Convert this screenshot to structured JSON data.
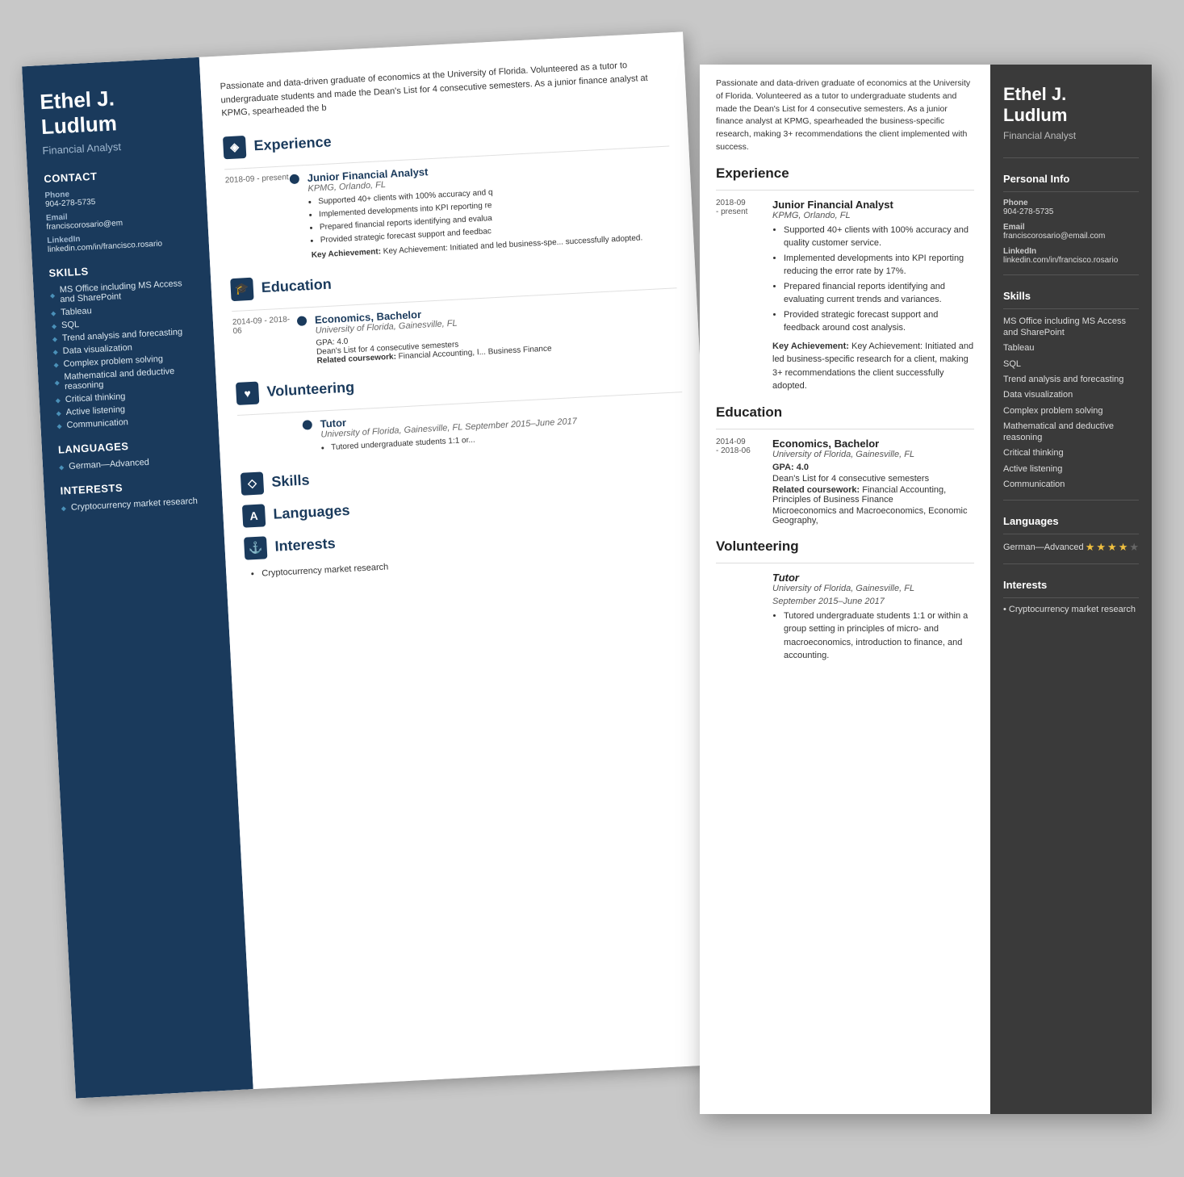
{
  "scene": {
    "bg": "#c8c8c8"
  },
  "resume_back": {
    "sidebar": {
      "name": "Ethel J. Ludlum",
      "title": "Financial Analyst",
      "phone_label": "Phone",
      "phone": "904-278-5735",
      "email_label": "Email",
      "email": "franciscorosario@em",
      "linkedin_label": "LinkedIn",
      "linkedin": "linkedin.com/in/francisco.rosario",
      "skills_label": "Skills",
      "skills": [
        "MS Office including MS Access and SharePoint",
        "Tableau",
        "SQL",
        "Trend analysis and forecasting",
        "Data visualization",
        "Complex problem solving",
        "Mathematical and deductive reasoning",
        "Critical thinking",
        "Active listening",
        "Communication"
      ],
      "languages_label": "Languages",
      "languages": "German—Advanced",
      "interests_label": "Interests",
      "interests": "Cryptocurrency market research"
    },
    "main": {
      "summary": "Passionate and data-driven graduate of economics at the University of Florida. Volunteered as a tutor to undergraduate students and made the Dean's List for 4 consecutive semesters. As a junior finance analyst at KPMG, spearheaded the b",
      "experience_title": "Experience",
      "exp_date": "2018-09 - present",
      "exp_job_title": "Junior Financial Analyst",
      "exp_company": "KPMG, Orlando, FL",
      "exp_bullets": [
        "Supported 40+ clients with 100% accuracy and q",
        "Implemented developments into KPI reporting re",
        "Prepared financial reports identifying and evalua",
        "Provided strategic forecast support and feedbac"
      ],
      "exp_key_ach": "Key Achievement: Initiated and led business-spe... successfully adopted.",
      "education_title": "Education",
      "edu_date": "2014-09 - 2018-06",
      "edu_degree": "Economics, Bachelor",
      "edu_school": "University of Florida, Gainesville, FL",
      "edu_gpa": "GPA: 4.0",
      "edu_deans": "Dean's List for 4 consecutive semesters",
      "edu_coursework_label": "Related coursework:",
      "edu_coursework": "Financial Accounting, I... Business Finance",
      "volunteering_title": "Volunteering",
      "vol_role": "Tutor",
      "vol_org": "University of Florida, Gainesville, FL September 2015–June 2017",
      "vol_bullet": "Tutored undergraduate students 1:1 or...",
      "skills_section_title": "Skills",
      "languages_section_title": "Languages",
      "interests_section_title": "Interests",
      "interests_bullet": "Cryptocurrency market research"
    }
  },
  "resume_front": {
    "main": {
      "summary": "Passionate and data-driven graduate of economics at the University of Florida. Volunteered as a tutor to undergraduate students and made the Dean's List for 4 consecutive semesters. As a junior finance analyst at KPMG, spearheaded the business-specific research, making 3+ recommendations the client implemented with success.",
      "experience_title": "Experience",
      "exp_date": "2018-09\n- present",
      "exp_job_title": "Junior Financial Analyst",
      "exp_company": "KPMG, Orlando, FL",
      "exp_bullet1": "Supported 40+ clients with 100% accuracy and quality customer service.",
      "exp_bullet2": "Implemented developments into KPI reporting reducing the error rate by 17%.",
      "exp_bullet3": "Prepared financial reports identifying and evaluating current trends and variances.",
      "exp_bullet4": "Provided strategic forecast support and feedback around cost analysis.",
      "exp_key_ach": "Key Achievement: Initiated and led business-specific research for a client, making 3+ recommendations the client successfully adopted.",
      "education_title": "Education",
      "edu_date": "2014-09\n- 2018-06",
      "edu_degree": "Economics, Bachelor",
      "edu_school": "University of Florida, Gainesville, FL",
      "edu_gpa_label": "GPA: 4.0",
      "edu_deans": "Dean's List for 4 consecutive semesters",
      "edu_coursework_label": "Related coursework:",
      "edu_coursework": "Financial Accounting, Principles of Business Finance",
      "edu_coursework2": "Microeconomics and Macroeconomics, Economic Geography,",
      "volunteering_title": "Volunteering",
      "vol_role": "Tutor",
      "vol_org": "University of Florida, Gainesville, FL",
      "vol_dates": "September 2015–June 2017",
      "vol_bullet": "Tutored undergraduate students 1:1 or within a group setting in principles of micro- and macroeconomics, introduction to finance, and accounting."
    },
    "sidebar": {
      "name": "Ethel J. Ludlum",
      "title": "Financial Analyst",
      "personal_info_label": "Personal Info",
      "phone_label": "Phone",
      "phone": "904-278-5735",
      "email_label": "Email",
      "email": "franciscorosario@email.com",
      "linkedin_label": "LinkedIn",
      "linkedin": "linkedin.com/in/francisco.rosario",
      "skills_label": "Skills",
      "skills": [
        "MS Office including MS Access and SharePoint",
        "Tableau",
        "SQL",
        "Trend analysis and forecasting",
        "Data visualization",
        "Complex problem solving",
        "Mathematical and deductive reasoning",
        "Critical thinking",
        "Active listening",
        "Communication"
      ],
      "languages_label": "Languages",
      "lang_name": "German—Advanced",
      "lang_stars_filled": 4,
      "lang_stars_empty": 1,
      "interests_label": "Interests",
      "interests": [
        "Cryptocurrency market research"
      ]
    }
  }
}
